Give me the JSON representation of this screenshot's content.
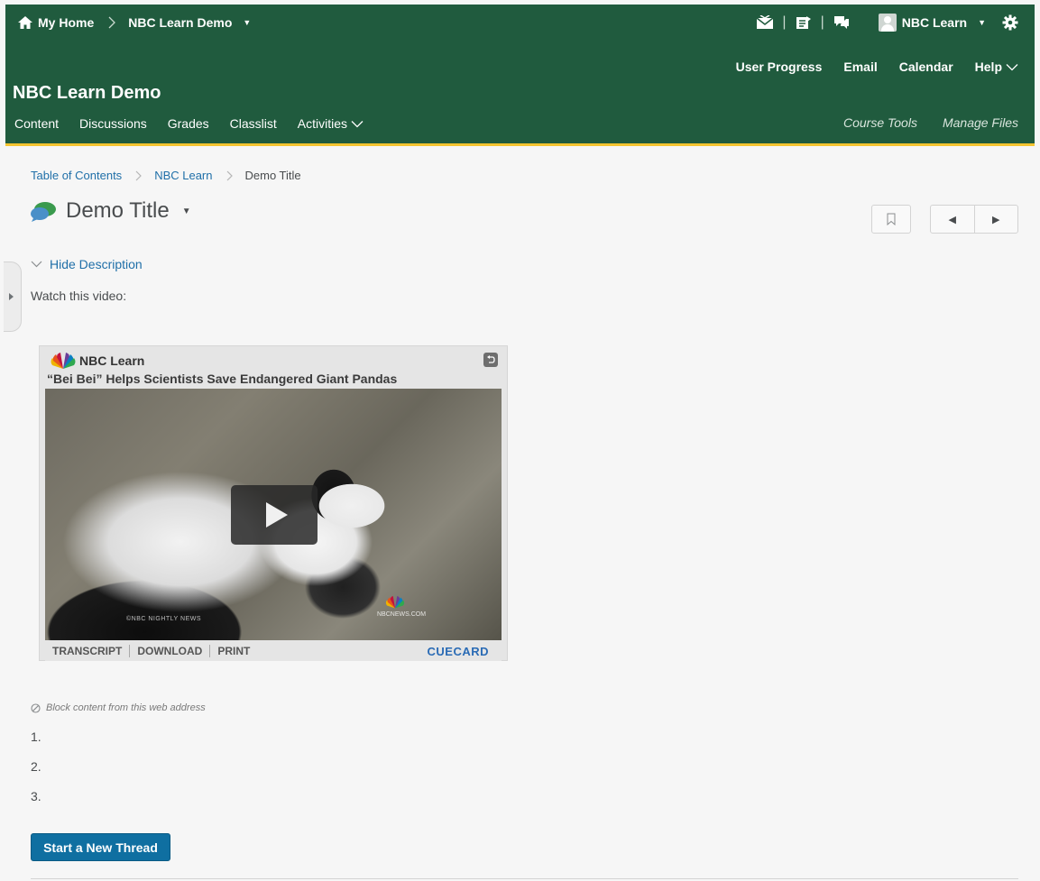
{
  "minibar": {
    "home_label": "My Home",
    "course_label": "NBC Learn Demo",
    "user_label": "NBC Learn",
    "icons": [
      "message-alerts-icon",
      "update-alerts-icon",
      "subscription-alerts-icon",
      "settings-gear-icon"
    ]
  },
  "course_header": {
    "title": "NBC Learn Demo",
    "util_links": [
      "User Progress",
      "Email",
      "Calendar",
      "Help"
    ],
    "nav_items": [
      "Content",
      "Discussions",
      "Grades",
      "Classlist",
      "Activities"
    ],
    "tools": [
      "Course Tools",
      "Manage Files"
    ],
    "colors": {
      "header_bg": "#205b3e",
      "accent_strip": "#f4c430"
    }
  },
  "breadcrumb": {
    "items": [
      "Table of Contents",
      "NBC Learn"
    ],
    "current": "Demo Title"
  },
  "page": {
    "title": "Demo Title",
    "hide_description": "Hide Description",
    "watch_text": "Watch this video:"
  },
  "video": {
    "brand": "NBC Learn",
    "title": "“Bei Bei” Helps Scientists Save Endangered Giant Pandas",
    "watermark_left": "©NBC NIGHTLY NEWS",
    "watermark_right": "NBCNEWS.COM",
    "footer_links": [
      "TRANSCRIPT",
      "DOWNLOAD",
      "PRINT"
    ],
    "cuecard": "CUECARD"
  },
  "block_text": "Block content from this web address",
  "numbers": [
    "1.",
    "2.",
    "3."
  ],
  "thread_button": "Start a New Thread",
  "colors": {
    "link": "#1f6fa8",
    "button": "#0f6fa1"
  }
}
